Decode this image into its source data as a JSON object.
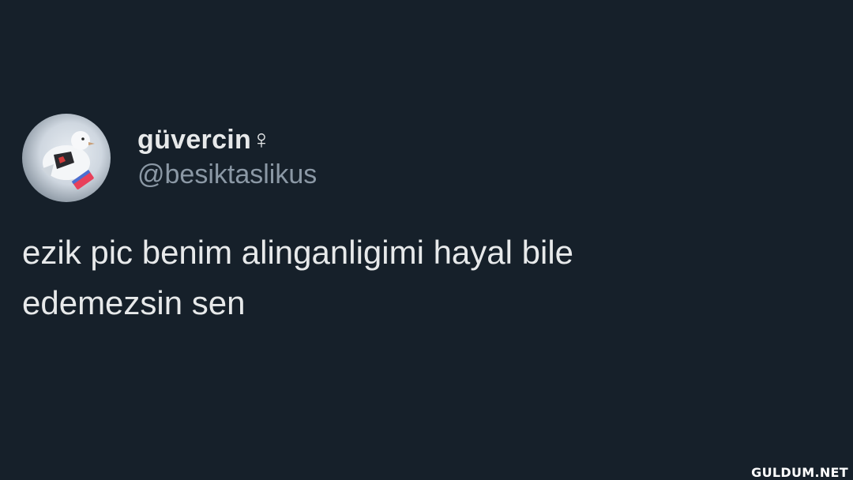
{
  "tweet": {
    "display_name": "güvercin♀",
    "handle": "@besiktaslikus",
    "text": "ezik pic benim alinganligimi hayal bile\nedemezsin sen",
    "avatar_icon": "pigeon-avatar-icon"
  },
  "watermark": {
    "text": "GULDUM.NET"
  },
  "colors": {
    "background": "#16202a",
    "primary_text": "#e7e9ea",
    "secondary_text": "#8b98a5"
  }
}
